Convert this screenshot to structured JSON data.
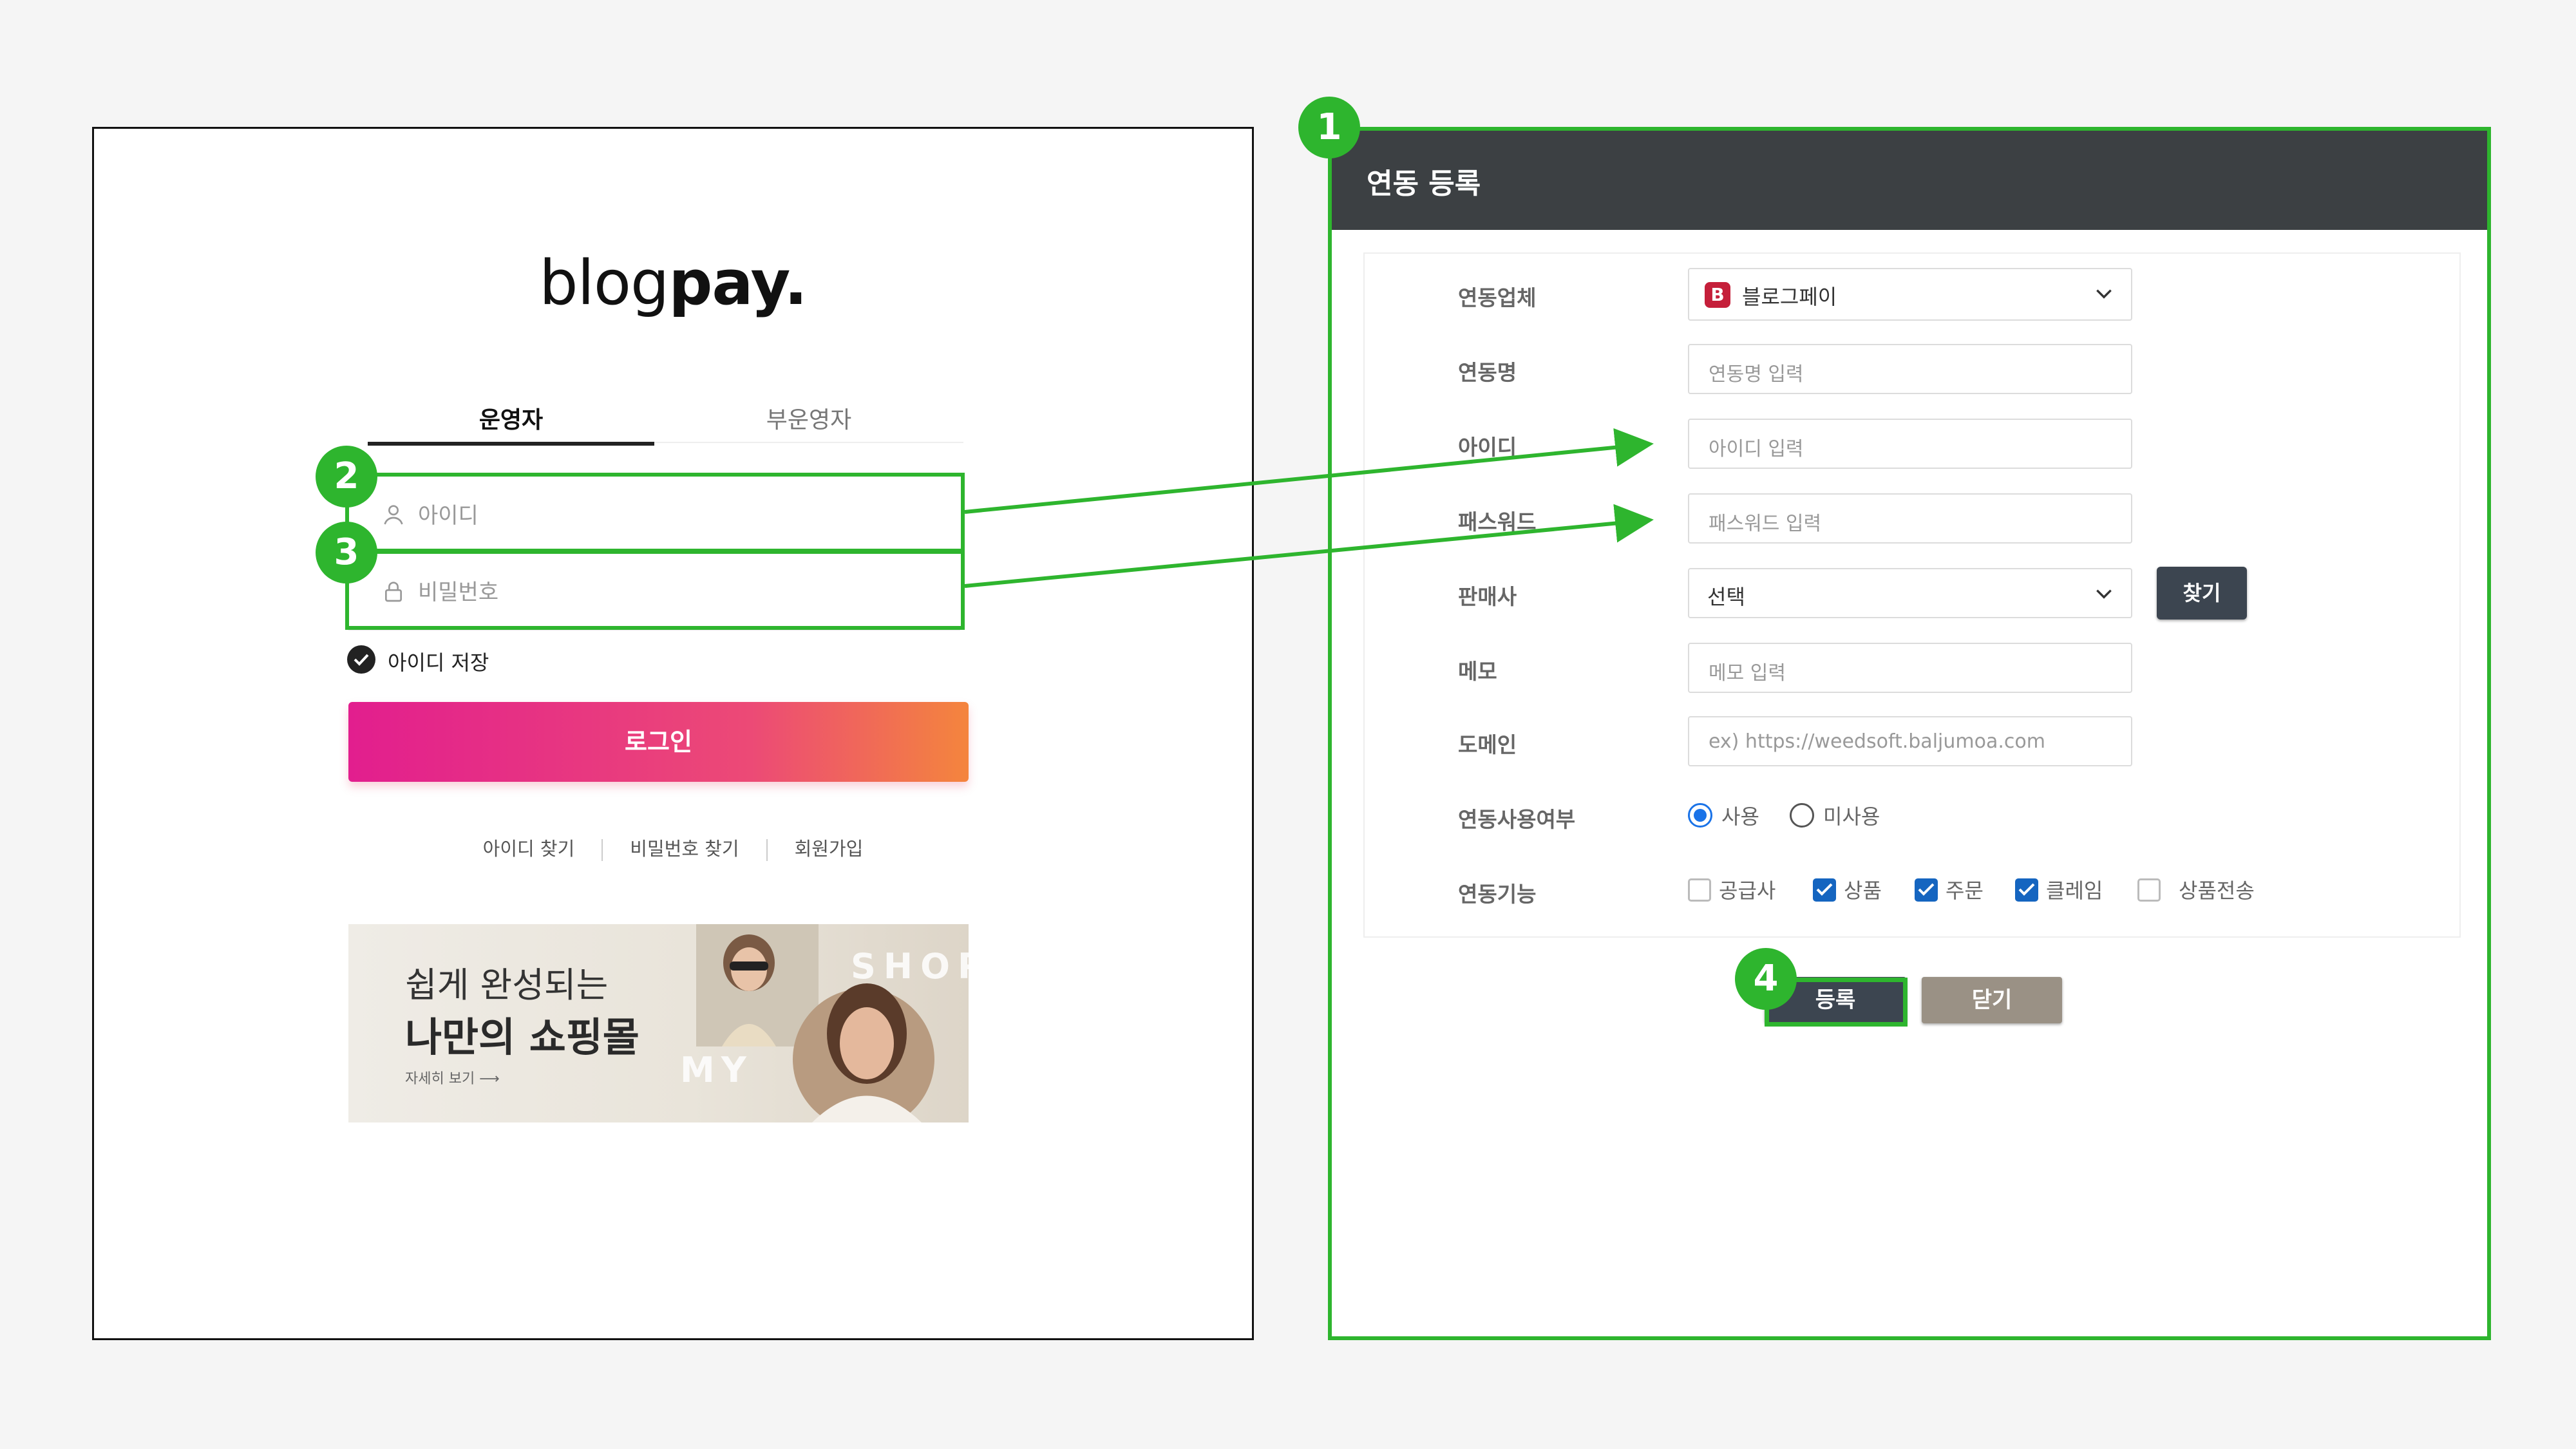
{
  "login": {
    "logo_light": "blog",
    "logo_bold": "pay.",
    "tabs": [
      "운영자",
      "부운영자"
    ],
    "id_placeholder": "아이디",
    "password_placeholder": "비밀번호",
    "save_id_label": "아이디 저장",
    "login_button": "로그인",
    "links": [
      "아이디 찾기",
      "비밀번호 찾기",
      "회원가입"
    ],
    "banner": {
      "line1": "쉽게 완성되는",
      "line2": "나만의 쇼핑몰",
      "more": "자세히 보기 ⟶",
      "word1": "SHOP",
      "word2": "MY"
    }
  },
  "dialog": {
    "title": "연동 등록",
    "fields": {
      "vendor_label": "연동업체",
      "vendor_badge": "B",
      "vendor_value": "블로그페이",
      "name_label": "연동명",
      "name_placeholder": "연동명 입력",
      "id_label": "아이디",
      "id_placeholder": "아이디 입력",
      "password_label": "패스워드",
      "password_placeholder": "패스워드 입력",
      "seller_label": "판매사",
      "seller_value": "선택",
      "find_button": "찾기",
      "memo_label": "메모",
      "memo_placeholder": "메모 입력",
      "domain_label": "도메인",
      "domain_placeholder": "ex) https://weedsoft.baljumoa.com",
      "usage_label": "연동사용여부",
      "usage_options": [
        "사용",
        "미사용"
      ],
      "usage_selected": "사용",
      "feature_label": "연동기능",
      "features": [
        {
          "label": "공급사",
          "checked": false
        },
        {
          "label": "상품",
          "checked": true
        },
        {
          "label": "주문",
          "checked": true
        },
        {
          "label": "클레임",
          "checked": true
        },
        {
          "label": "상품전송",
          "checked": false
        }
      ]
    },
    "register_button": "등록",
    "close_button": "닫기"
  },
  "annotations": {
    "markers": [
      "1",
      "2",
      "3",
      "4"
    ],
    "accent_color": "#2eb52e"
  },
  "colors": {
    "login_gradient_start": "#e21e8e",
    "login_gradient_end": "#f4853d",
    "dialog_header": "#3c4043",
    "checkbox_blue": "#1565c0"
  }
}
